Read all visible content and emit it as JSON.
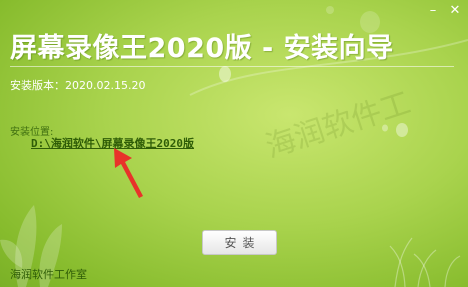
{
  "window": {
    "title": "屏幕录像王2020版 - 安装向导",
    "minimize_glyph": "–",
    "close_glyph": "✕"
  },
  "version": {
    "label": "安装版本：2020.02.15.20"
  },
  "install": {
    "location_label": "安装位置:",
    "path": "D:\\海润软件\\屏幕录像王2020版",
    "button_label": "安装"
  },
  "footer": {
    "studio": "海润软件工作室"
  },
  "watermark": {
    "text": "海润软件工"
  },
  "colors": {
    "background": "#a9d34d",
    "title": "#ffffff",
    "path_link": "#2f5d07",
    "arrow": "#e8332a"
  },
  "icons": {
    "minimize": "minimize-icon",
    "close": "close-icon",
    "arrow": "red-arrow-pointer"
  }
}
